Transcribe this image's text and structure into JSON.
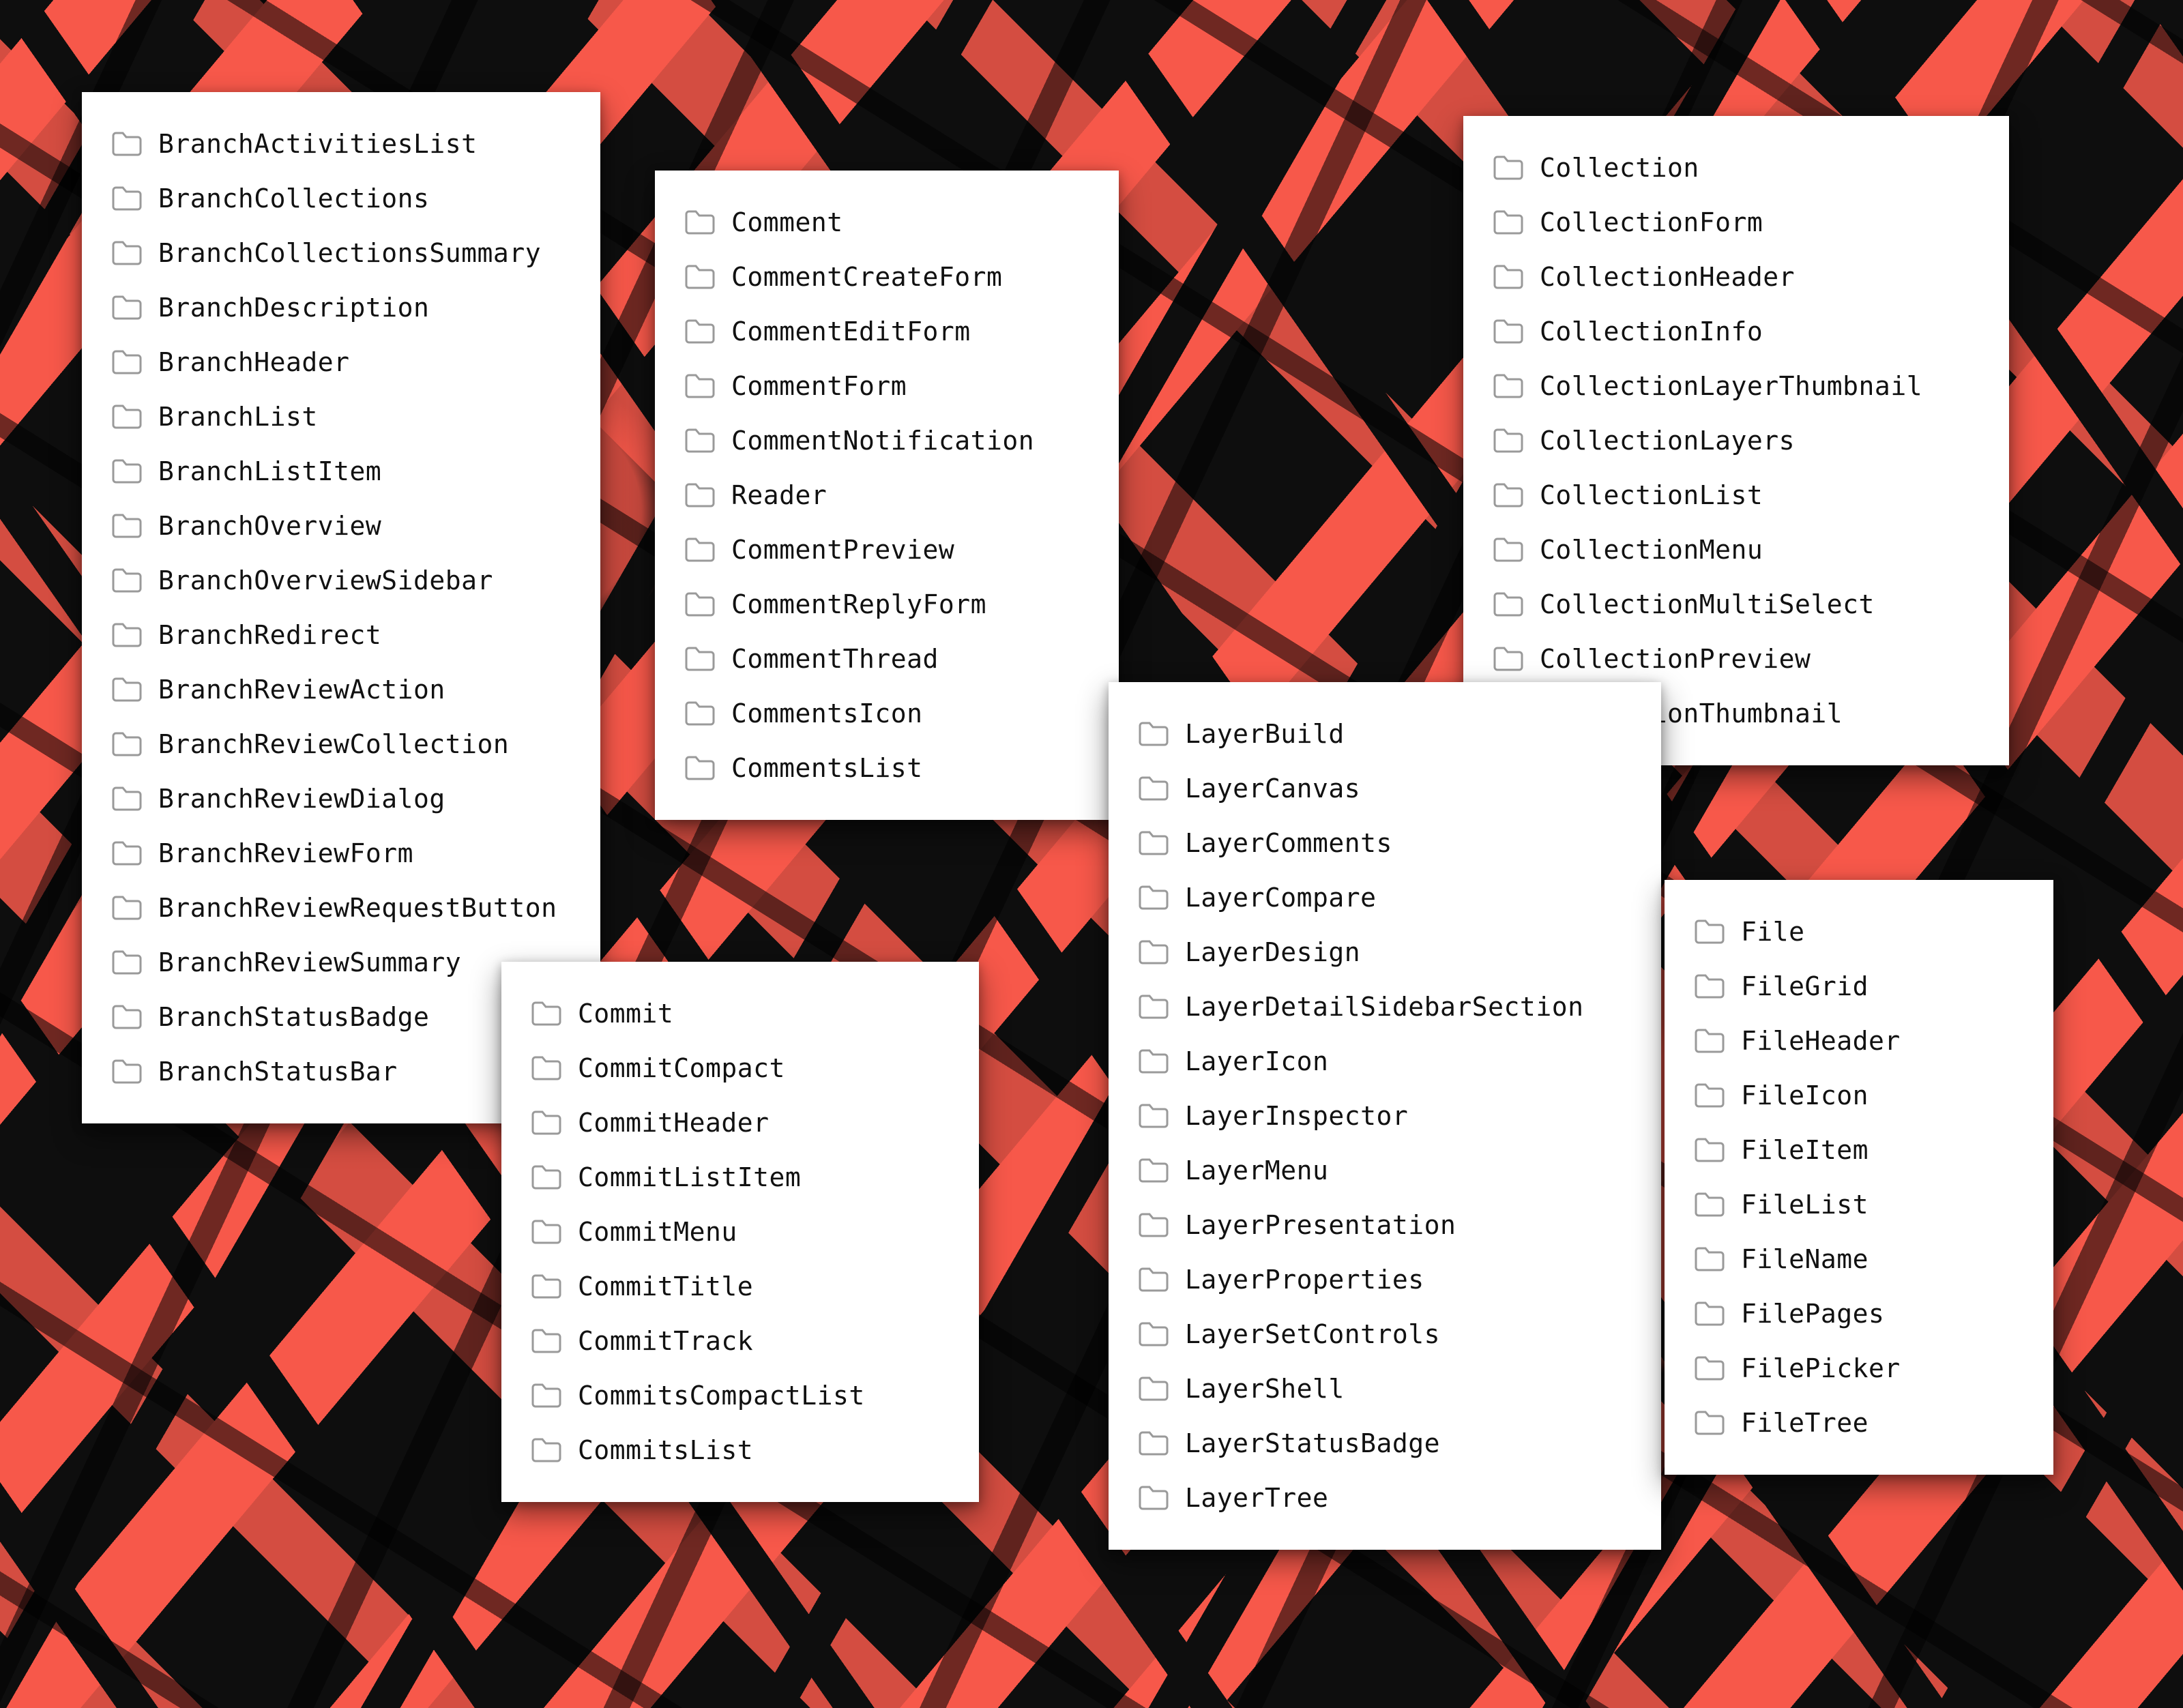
{
  "cards": [
    {
      "id": "branch",
      "items": [
        "BranchActivitiesList",
        "BranchCollections",
        "BranchCollectionsSummary",
        "BranchDescription",
        "BranchHeader",
        "BranchList",
        "BranchListItem",
        "BranchOverview",
        "BranchOverviewSidebar",
        "BranchRedirect",
        "BranchReviewAction",
        "BranchReviewCollection",
        "BranchReviewDialog",
        "BranchReviewForm",
        "BranchReviewRequestButton",
        "BranchReviewSummary",
        "BranchStatusBadge",
        "BranchStatusBar"
      ]
    },
    {
      "id": "comment",
      "items": [
        "Comment",
        "CommentCreateForm",
        "CommentEditForm",
        "CommentForm",
        "CommentNotification",
        "Reader",
        "CommentPreview",
        "CommentReplyForm",
        "CommentThread",
        "CommentsIcon",
        "CommentsList"
      ]
    },
    {
      "id": "collection",
      "items": [
        "Collection",
        "CollectionForm",
        "CollectionHeader",
        "CollectionInfo",
        "CollectionLayerThumbnail",
        "CollectionLayers",
        "CollectionList",
        "CollectionMenu",
        "CollectionMultiSelect",
        "CollectionPreview",
        "CollectionThumbnail"
      ]
    },
    {
      "id": "commit",
      "items": [
        "Commit",
        "CommitCompact",
        "CommitHeader",
        "CommitListItem",
        "CommitMenu",
        "CommitTitle",
        "CommitTrack",
        "CommitsCompactList",
        "CommitsList"
      ]
    },
    {
      "id": "layer",
      "items": [
        "LayerBuild",
        "LayerCanvas",
        "LayerComments",
        "LayerCompare",
        "LayerDesign",
        "LayerDetailSidebarSection",
        "LayerIcon",
        "LayerInspector",
        "LayerMenu",
        "LayerPresentation",
        "LayerProperties",
        "LayerSetControls",
        "LayerShell",
        "LayerStatusBadge",
        "LayerTree"
      ]
    },
    {
      "id": "file",
      "items": [
        "File",
        "FileGrid",
        "FileHeader",
        "FileIcon",
        "FileItem",
        "FileList",
        "FileName",
        "FilePages",
        "FilePicker",
        "FileTree"
      ]
    }
  ]
}
